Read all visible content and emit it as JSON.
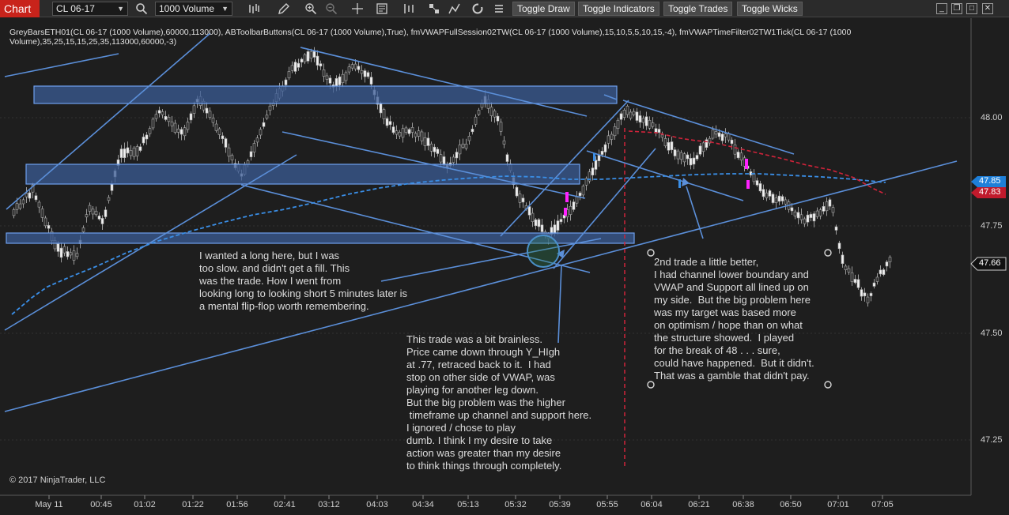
{
  "toolbar": {
    "title": "Chart",
    "instrument": "CL 06-17",
    "bar_type": "1000 Volume",
    "toggle_draw": "Toggle Draw",
    "toggle_indicators": "Toggle Indicators",
    "toggle_trades": "Toggle Trades",
    "toggle_wicks": "Toggle Wicks"
  },
  "indicators_line": "GreyBarsETH01(CL 06-17 (1000 Volume),60000,113000), ABToolbarButtons(CL 06-17 (1000 Volume),True), fmVWAPFullSession02TW(CL 06-17 (1000 Volume),15,10,5,5,10,15,-4), fmVWAPTimeFilter02TW1Tick(CL 06-17 (1000 Volume),35,25,15,15,25,35,113000,60000,-3)",
  "y_axis": [
    "48.00",
    "47.75",
    "47.50",
    "47.25"
  ],
  "x_axis": [
    "May 11",
    "00:45",
    "01:02",
    "01:22",
    "01:56",
    "02:41",
    "03:12",
    "04:03",
    "04:34",
    "05:13",
    "05:32",
    "05:39",
    "05:55",
    "06:04",
    "06:21",
    "06:38",
    "06:50",
    "07:01",
    "07:05"
  ],
  "price_markers": {
    "blue": "47.85",
    "red": "47.83",
    "last": "47.66"
  },
  "annotations": {
    "note1": "I wanted a long here, but I was\ntoo slow. and didn't get a fill. This\nwas the trade. How I went from\nlooking long to looking short 5 minutes later is\na mental flip-flop worth remembering.",
    "note2": "This trade was a bit brainless.\nPrice came down through Y_HIgh\nat .77, retraced back to it.  I had\nstop on other side of VWAP, was\nplaying for another leg down.\nBut the big problem was the higher\n timeframe up channel and support here.\nI ignored / chose to play\ndumb. I think I my desire to take\naction was greater than my desire\nto think things through completely.",
    "note3": "2nd trade a little better,\nI had channel lower boundary and\nVWAP and Support all lined up on\nmy side.  But the big problem here\nwas my target was based more\non optimism / hope than on what\nthe structure showed.  I played\nfor the break of 48 . . . sure,\ncould have happened.  But it didn't.\nThat was a gamble that didn't pay."
  },
  "copyright": "© 2017 NinjaTrader, LLC",
  "colors": {
    "background": "#1e1e1e",
    "zone_fill": "#3b5c95",
    "line": "#5b8fd9",
    "vwap": "#3a8ee6",
    "vwap_filter": "#d0233a",
    "marker": "#ff22ff"
  }
}
